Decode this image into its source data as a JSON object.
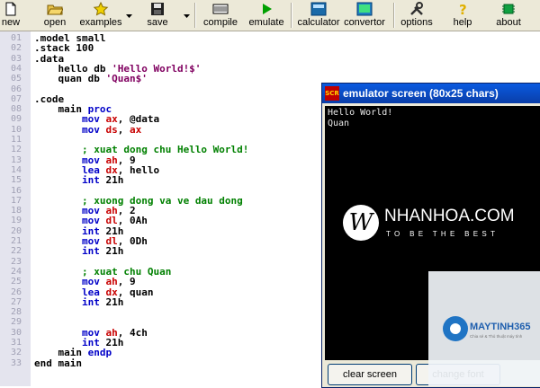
{
  "toolbar": {
    "buttons": [
      {
        "id": "new",
        "label": "new",
        "icon": "new-file-icon"
      },
      {
        "id": "open",
        "label": "open",
        "icon": "open-folder-icon"
      },
      {
        "id": "examples",
        "label": "examples",
        "icon": "star-icon"
      },
      {
        "id": "save",
        "label": "save",
        "icon": "floppy-disk-icon"
      },
      {
        "id": "compile",
        "label": "compile",
        "icon": "compile-icon"
      },
      {
        "id": "emulate",
        "label": "emulate",
        "icon": "play-icon"
      },
      {
        "id": "calculator",
        "label": "calculator",
        "icon": "calculator-icon"
      },
      {
        "id": "convertor",
        "label": "convertor",
        "icon": "convertor-icon"
      },
      {
        "id": "options",
        "label": "options",
        "icon": "tools-icon"
      },
      {
        "id": "help",
        "label": "help",
        "icon": "help-icon"
      },
      {
        "id": "about",
        "label": "about",
        "icon": "chip-icon"
      }
    ]
  },
  "editor": {
    "lines": [
      {
        "n": "01",
        "t": ".model small"
      },
      {
        "n": "02",
        "t": ".stack 100"
      },
      {
        "n": "03",
        "t": ".data"
      },
      {
        "n": "04",
        "t": "    hello db 'Hello World!$'"
      },
      {
        "n": "05",
        "t": "    quan db 'Quan$'"
      },
      {
        "n": "06",
        "t": ""
      },
      {
        "n": "07",
        "t": ".code"
      },
      {
        "n": "08",
        "t": "    main proc"
      },
      {
        "n": "09",
        "t": "        mov ax, @data"
      },
      {
        "n": "10",
        "t": "        mov ds, ax"
      },
      {
        "n": "11",
        "t": ""
      },
      {
        "n": "12",
        "t": "        ; xuat dong chu Hello World!"
      },
      {
        "n": "13",
        "t": "        mov ah, 9"
      },
      {
        "n": "14",
        "t": "        lea dx, hello"
      },
      {
        "n": "15",
        "t": "        int 21h"
      },
      {
        "n": "16",
        "t": ""
      },
      {
        "n": "17",
        "t": "        ; xuong dong va ve dau dong"
      },
      {
        "n": "18",
        "t": "        mov ah, 2"
      },
      {
        "n": "19",
        "t": "        mov dl, 0Ah"
      },
      {
        "n": "20",
        "t": "        int 21h"
      },
      {
        "n": "21",
        "t": "        mov dl, 0Dh"
      },
      {
        "n": "22",
        "t": "        int 21h"
      },
      {
        "n": "23",
        "t": ""
      },
      {
        "n": "24",
        "t": "        ; xuat chu Quan"
      },
      {
        "n": "25",
        "t": "        mov ah, 9"
      },
      {
        "n": "26",
        "t": "        lea dx, quan"
      },
      {
        "n": "27",
        "t": "        int 21h"
      },
      {
        "n": "28",
        "t": ""
      },
      {
        "n": "29",
        "t": ""
      },
      {
        "n": "30",
        "t": "        mov ah, 4ch"
      },
      {
        "n": "31",
        "t": "        int 21h"
      },
      {
        "n": "32",
        "t": "    main endp"
      },
      {
        "n": "33",
        "t": "end main"
      }
    ]
  },
  "emulator": {
    "title": "emulator screen (80x25 chars)",
    "app_icon_text": "SCR",
    "output": [
      "Hello World!",
      "Quan"
    ],
    "buttons": {
      "clear": "clear screen",
      "font": "change font"
    }
  },
  "watermark": {
    "logo_letter": "W",
    "brand": "NHANHOA.COM",
    "tagline": "TO BE THE BEST"
  },
  "overlay": {
    "brand": "MAYTINH365",
    "subtitle": "Chia sẻ & Thủ thuật máy tính"
  },
  "colors": {
    "keyword": "#0000c8",
    "register": "#c80000",
    "string": "#800060",
    "comment": "#008000"
  }
}
